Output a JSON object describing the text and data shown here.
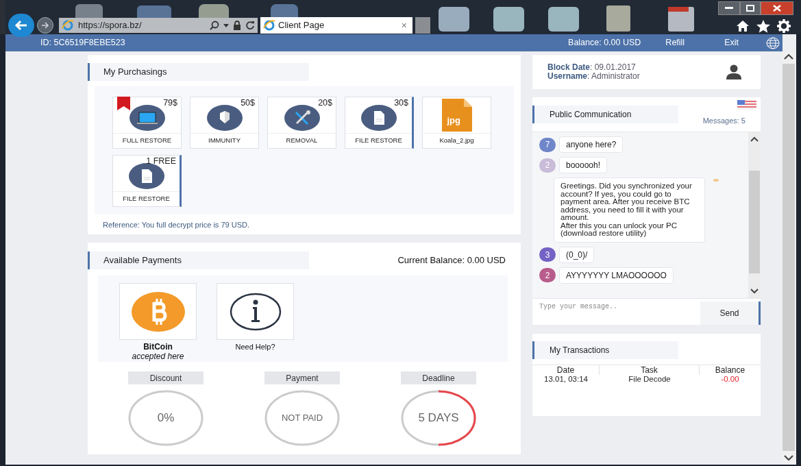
{
  "browser": {
    "url": "https://spora.bz/",
    "tab_title": "Client Page",
    "tab_close": "×"
  },
  "topbar": {
    "id": "ID: 5C6519F8EBE523",
    "balance": "Balance: 0.00 USD",
    "links": [
      "Refill",
      "Exit"
    ]
  },
  "purchasings": {
    "title": "My Purchasings",
    "tiles": [
      {
        "kind": "laptop",
        "price": "79$",
        "label": "FULL RESTORE",
        "bookmarked": true,
        "selected": false
      },
      {
        "kind": "shield",
        "price": "50$",
        "label": "IMMUNITY",
        "bookmarked": false,
        "selected": false
      },
      {
        "kind": "tools",
        "price": "20$",
        "label": "REMOVAL",
        "bookmarked": false,
        "selected": false
      },
      {
        "kind": "document",
        "price": "30$",
        "label": "FILE RESTORE",
        "bookmarked": false,
        "selected": true
      },
      {
        "kind": "jpg",
        "badge": "jpg",
        "label": "Koala_2.jpg",
        "bookmarked": false,
        "selected": false
      },
      {
        "kind": "document",
        "price": "1 FREE",
        "label": "FILE RESTORE",
        "bookmarked": false,
        "selected": true
      }
    ],
    "reference": "Reference: You full decrypt price is 79 USD."
  },
  "payments": {
    "title": "Available Payments",
    "current_balance": "Current Balance: 0.00 USD",
    "methods": [
      {
        "kind": "bitcoin",
        "name": "BitCoin",
        "note": "accepted here"
      },
      {
        "kind": "info",
        "name": "Need Help?"
      }
    ],
    "gauges": [
      {
        "kind": "plain",
        "label": "Discount",
        "value": "0%"
      },
      {
        "kind": "plain",
        "label": "Payment",
        "value": "NOT PAID"
      },
      {
        "kind": "countdown",
        "label": "Deadline",
        "value": "5 DAYS"
      }
    ]
  },
  "account": {
    "block_date": "**Block Date**: 09.01.2017",
    "username": "**Username**: Administrator"
  },
  "chat": {
    "title": "Public Communication",
    "messages_count": "Messages: 5",
    "messages": [
      {
        "kind": "user",
        "avatar": "7",
        "color": "#6f86c9",
        "text": "anyone here?"
      },
      {
        "kind": "user",
        "avatar": "2",
        "color": "#c8bcd8",
        "text": "boooooh!"
      },
      {
        "kind": "reply",
        "text": "Greetings. Did you synchronized your account? If yes, you could go to payment area. After you receive BTC address, you need to fill it with your amount.\nAfter this you can unlock your PC (download restore utility)"
      },
      {
        "kind": "user",
        "avatar": "3",
        "color": "#7462c4",
        "text": "(0_0)/"
      },
      {
        "kind": "user",
        "avatar": "2",
        "color": "#b85c8c",
        "text": "AYYYYYYY LMAOOOOOO"
      }
    ],
    "input": {
      "placeholder": "Type your message.."
    },
    "send": "Send"
  },
  "transactions": {
    "title": "My Transactions",
    "columns": [
      "Date",
      "Task",
      "Balance"
    ],
    "rows": [
      [
        "13.01, 03:14",
        "File Decode",
        "-0.00"
      ]
    ]
  }
}
